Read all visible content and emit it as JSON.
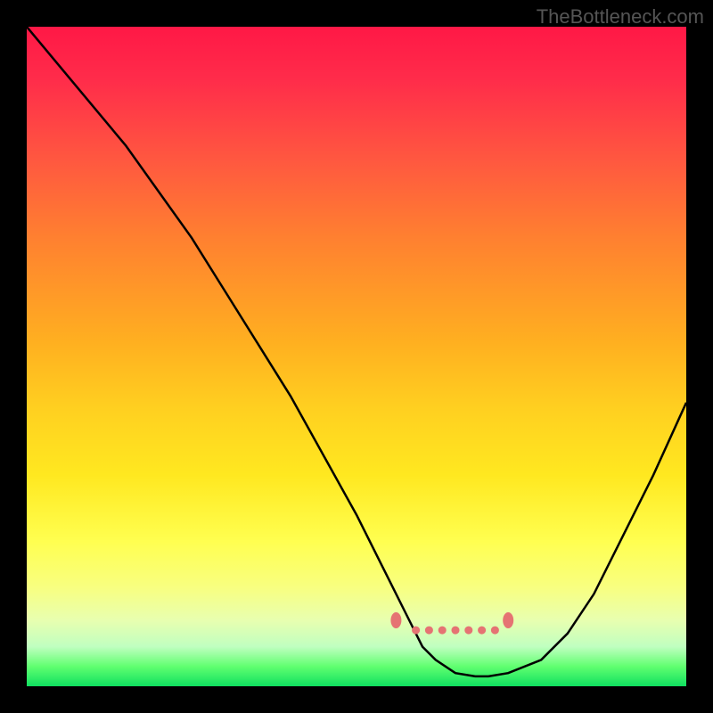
{
  "watermark": "TheBottleneck.com",
  "chart_data": {
    "type": "line",
    "title": "",
    "xlabel": "",
    "ylabel": "",
    "xlim": [
      0,
      100
    ],
    "ylim": [
      0,
      100
    ],
    "grid": false,
    "curve": {
      "x": [
        0,
        5,
        10,
        15,
        20,
        25,
        30,
        35,
        40,
        45,
        50,
        55,
        58,
        60,
        62,
        65,
        68,
        70,
        73,
        78,
        82,
        86,
        90,
        95,
        100
      ],
      "y": [
        100,
        94,
        88,
        82,
        75,
        68,
        60,
        52,
        44,
        35,
        26,
        16,
        10,
        6,
        4,
        2,
        1.5,
        1.5,
        2,
        4,
        8,
        14,
        22,
        32,
        43
      ],
      "color": "#000000"
    },
    "flat_zone": {
      "x_start": 56,
      "x_end": 73,
      "marker_color": "#e57373",
      "endpoints": [
        {
          "x": 56,
          "y": 10
        },
        {
          "x": 73,
          "y": 10
        }
      ],
      "dots": [
        {
          "x": 59,
          "y": 8.5
        },
        {
          "x": 61,
          "y": 8.5
        },
        {
          "x": 63,
          "y": 8.5
        },
        {
          "x": 65,
          "y": 8.5
        },
        {
          "x": 67,
          "y": 8.5
        },
        {
          "x": 69,
          "y": 8.5
        },
        {
          "x": 71,
          "y": 8.5
        }
      ]
    },
    "gradient_stops": [
      {
        "pos": 0,
        "color": "#ff1846"
      },
      {
        "pos": 50,
        "color": "#ffd020"
      },
      {
        "pos": 100,
        "color": "#10e060"
      }
    ]
  }
}
